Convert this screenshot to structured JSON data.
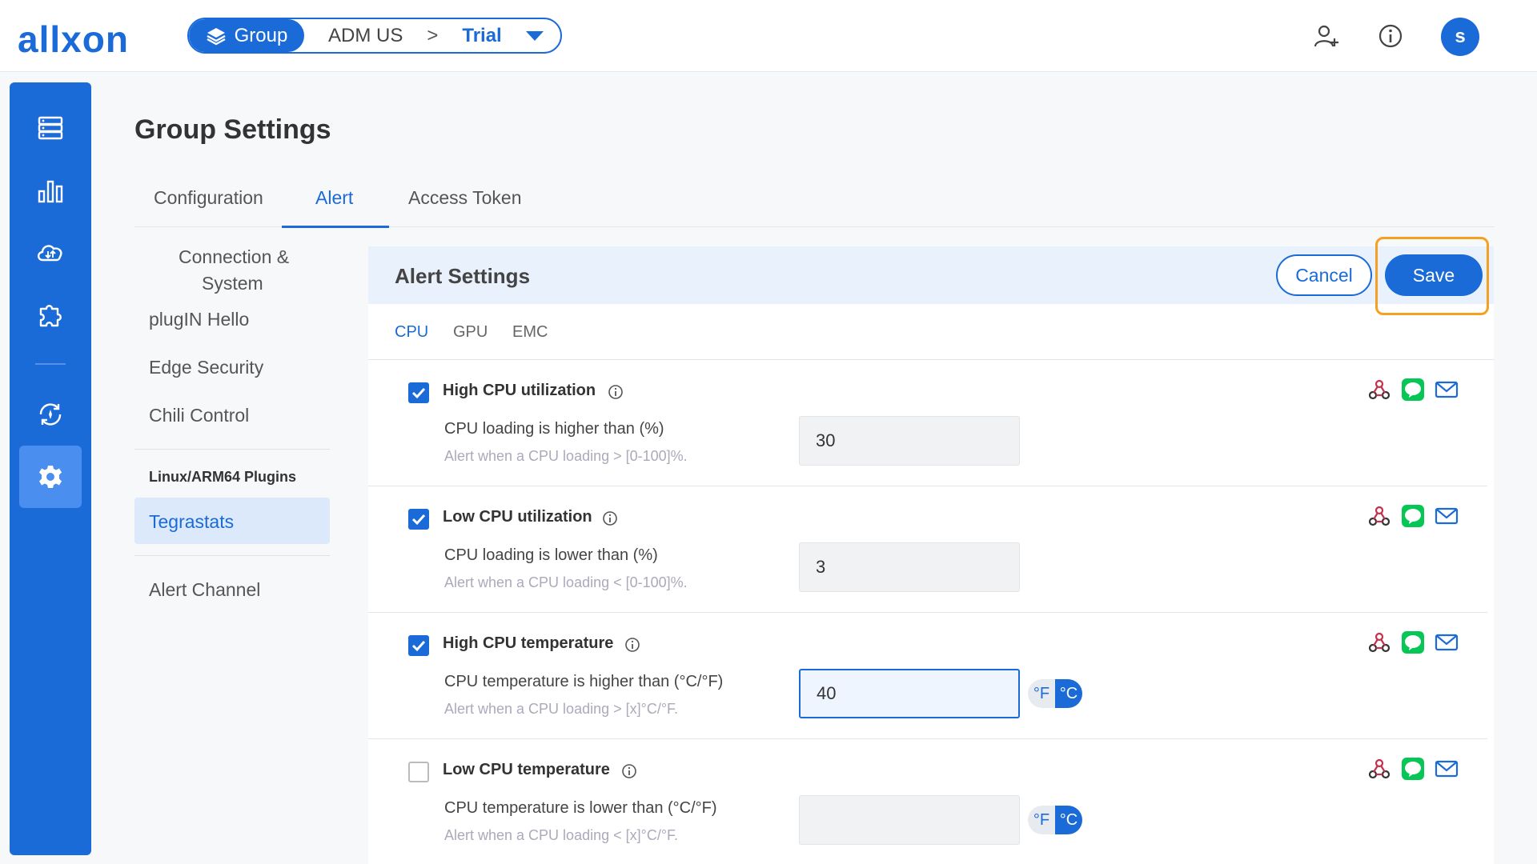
{
  "header": {
    "logo": "allxon",
    "breadcrumb": {
      "group_label": "Group",
      "parent": "ADM US",
      "separator": ">",
      "current": "Trial"
    },
    "avatar_initial": "s"
  },
  "page": {
    "title": "Group Settings"
  },
  "tabs": [
    {
      "label": "Configuration"
    },
    {
      "label": "Alert"
    },
    {
      "label": "Access Token"
    }
  ],
  "subnav": {
    "items": [
      {
        "label": "Connection &"
      },
      {
        "label": "System"
      },
      {
        "label": "plugIN Hello"
      },
      {
        "label": "Edge Security"
      },
      {
        "label": "Chili Control"
      }
    ],
    "section_heading": "Linux/ARM64 Plugins",
    "active_item": "Tegrastats",
    "footer_item": "Alert Channel"
  },
  "card": {
    "title": "Alert Settings",
    "cancel_label": "Cancel",
    "save_label": "Save",
    "subtabs": [
      {
        "label": "CPU"
      },
      {
        "label": "GPU"
      },
      {
        "label": "EMC"
      }
    ],
    "rows": [
      {
        "title": "High CPU utilization",
        "checked": true,
        "label": "CPU loading is higher than (%)",
        "hint": "Alert when a CPU loading > [0-100]%.",
        "value": "30"
      },
      {
        "title": "Low CPU utilization",
        "checked": true,
        "label": "CPU loading is lower than (%)",
        "hint": "Alert when a CPU loading < [0-100]%.",
        "value": "3"
      },
      {
        "title": "High CPU temperature",
        "checked": true,
        "label": "CPU temperature is higher than (°C/°F)",
        "hint": "Alert when a CPU loading > [x]°C/°F.",
        "value": "40",
        "unit_f": "°F",
        "unit_c": "°C"
      },
      {
        "title": "Low CPU temperature",
        "checked": false,
        "label": "CPU temperature is lower than (°C/°F)",
        "hint": "Alert when a CPU loading < [x]°C/°F.",
        "value": "",
        "unit_f": "°F",
        "unit_c": "°C"
      }
    ]
  },
  "colors": {
    "accent": "#1a6bd8",
    "highlight": "#f5a020",
    "line_green": "#06c755",
    "webhook_red": "#c6304a"
  }
}
